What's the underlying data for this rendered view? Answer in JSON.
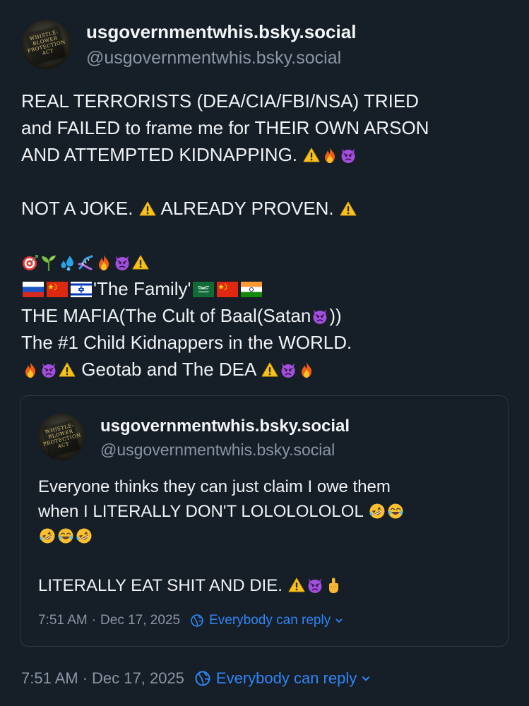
{
  "post": {
    "author": {
      "display_name": "usgovernmentwhis.bsky.social",
      "handle": "@usgovernmentwhis.bsky.social",
      "avatar_text": "Whistleblower Protection Act"
    },
    "text_lines": [
      "REAL TERRORISTS (DEA/CIA/FBI/NSA) TRIED",
      "and FAILED to frame me for THEIR OWN ARSON",
      "AND ATTEMPTED KIDNAPPING.",
      "NOT A JOKE.",
      "ALREADY PROVEN.",
      "'The Family'",
      "THE MAFIA(The Cult of Baal(Satan",
      "))",
      "The #1 Child Kidnappers in the WORLD.",
      "Geotab and The DEA"
    ],
    "timestamp": "7:51 AM · Dec 17, 2025",
    "timestamp_time": "7:51 AM",
    "timestamp_date": "Dec 17, 2025",
    "reply_setting": "Everybody can reply"
  },
  "quote": {
    "author": {
      "display_name": "usgovernmentwhis.bsky.social",
      "handle": "@usgovernmentwhis.bsky.social",
      "avatar_text": "Whistleblower Protection Act"
    },
    "text_lines": [
      "Everyone thinks they can just claim I owe them",
      "when I LITERALLY DON'T LOLOLOLOLOL",
      "LITERALLY EAT SHIT AND DIE."
    ],
    "timestamp_time": "7:51 AM",
    "timestamp_date": "Dec 17, 2025",
    "reply_setting": "Everybody can reply"
  },
  "colors": {
    "background": "#161e27",
    "text": "#f1f3f5",
    "muted": "#8a96a6",
    "accent": "#2f86f4",
    "border": "#2d3744"
  },
  "icons": [
    "warning-emoji",
    "fire-emoji",
    "angry-devil-emoji",
    "target-emoji",
    "seedling-emoji",
    "sweat-droplets-emoji",
    "dna-emoji",
    "russia-flag",
    "china-flag",
    "israel-flag",
    "saudi-arabia-flag",
    "india-flag",
    "rolling-laughing-emoji",
    "tears-of-joy-emoji",
    "pointing-up-emoji",
    "globe-icon",
    "chevron-down-icon"
  ]
}
